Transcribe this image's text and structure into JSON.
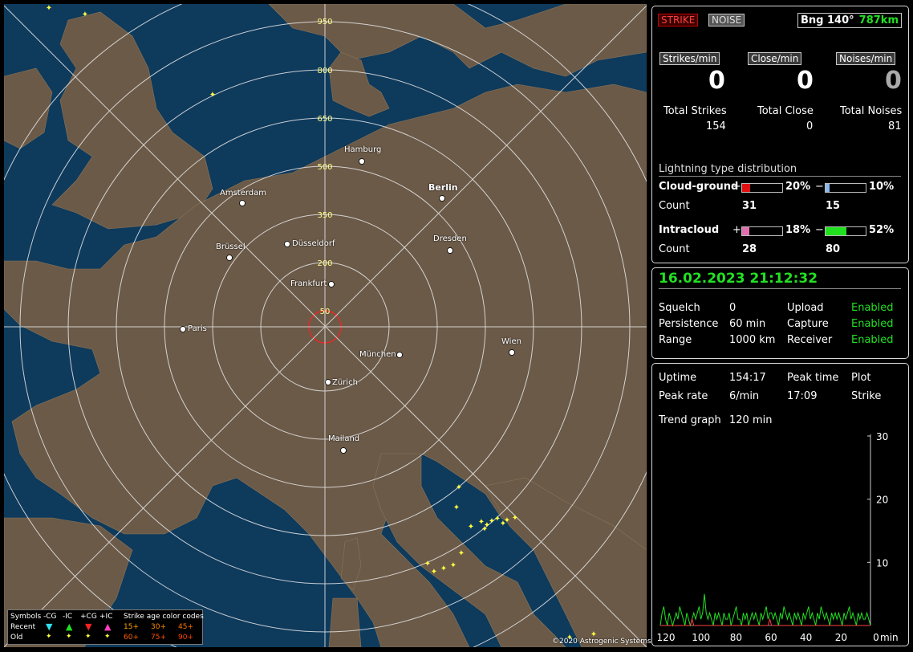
{
  "map": {
    "range_labels": [
      "950",
      "800",
      "650",
      "500",
      "350",
      "200",
      "50"
    ],
    "cities": [
      "Hamburg",
      "Berlin",
      "Amsterdam",
      "Düsseldorf",
      "Brüssel",
      "Dresden",
      "Frankfurt",
      "Paris",
      "Wien",
      "München",
      "Zürich",
      "Mailand"
    ],
    "copyright": "©2020 Astrogenic Systems",
    "legend": {
      "symbols_label": "Symbols",
      "types": [
        "-CG",
        "-IC",
        "+CG",
        "+IC"
      ],
      "recent_label": "Recent",
      "old_label": "Old",
      "age_title": "Strike age color codes",
      "age_recent": [
        "15+",
        "30+",
        "45+"
      ],
      "age_old": [
        "60+",
        "75+",
        "90+"
      ]
    },
    "colors": {
      "sea": "#0e3a5c",
      "land": "#6b5a48",
      "strike": "#ffff40"
    }
  },
  "top": {
    "strike_btn": "STRIKE",
    "noise_btn": "NOISE",
    "bearing_label": "Bng 140°",
    "bearing_distance": "787km",
    "rate_headers": [
      "Strikes/min",
      "Close/min",
      "Noises/min"
    ],
    "rates": [
      "0",
      "0",
      "0"
    ],
    "totals_labels": [
      "Total Strikes",
      "Total Close",
      "Total Noises"
    ],
    "totals": [
      "154",
      "0",
      "81"
    ],
    "dist_title": "Lightning type distribution",
    "cloud_ground_label": "Cloud-ground",
    "intracloud_label": "Intracloud",
    "count_label": "Count",
    "plus": "+",
    "minus": "−",
    "cg_pos_pct": "20%",
    "cg_neg_pct": "10%",
    "cg_pos_count": "31",
    "cg_neg_count": "15",
    "ic_pos_pct": "18%",
    "ic_neg_pct": "52%",
    "ic_pos_count": "28",
    "ic_neg_count": "80",
    "fractions": {
      "cg_pos": 0.2,
      "cg_neg": 0.1,
      "ic_pos": 0.18,
      "ic_neg": 0.52
    },
    "colors": {
      "cg_pos": "#e01010",
      "cg_neg": "#8ab8e8",
      "ic_pos": "#e070b0",
      "ic_neg": "#20e020"
    }
  },
  "status": {
    "datetime": "16.02.2023 21:12:32",
    "squelch_label": "Squelch",
    "squelch": "0",
    "persistence_label": "Persistence",
    "persistence": "60 min",
    "range_label": "Range",
    "range": "1000 km",
    "upload_label": "Upload",
    "upload": "Enabled",
    "capture_label": "Capture",
    "capture": "Enabled",
    "receiver_label": "Receiver",
    "receiver": "Enabled"
  },
  "stats": {
    "uptime_label": "Uptime",
    "uptime": "154:17",
    "peak_time_label": "Peak time",
    "peak_time": "17:09",
    "plot_label": "Plot",
    "plot": "Strike",
    "peak_rate_label": "Peak rate",
    "peak_rate": "6/min",
    "trend_label": "Trend graph",
    "trend": "120 min"
  },
  "chart_data": {
    "type": "line",
    "title": "",
    "xlabel": "min",
    "ylabel": "",
    "x_ticks": [
      "120",
      "100",
      "80",
      "60",
      "40",
      "20",
      "0"
    ],
    "y_ticks": [
      "10",
      "20",
      "30"
    ],
    "xlim": [
      120,
      0
    ],
    "ylim": [
      0,
      30
    ],
    "series": [
      {
        "color": "#20e020",
        "values": [
          0,
          2,
          3,
          1,
          0,
          2,
          1,
          0,
          1,
          2,
          1,
          3,
          2,
          1,
          0,
          2,
          1,
          0,
          1,
          2,
          1,
          2,
          3,
          1,
          2,
          5,
          2,
          1,
          2,
          1,
          0,
          2,
          1,
          2,
          1,
          0,
          2,
          1,
          1,
          2,
          0,
          1,
          2,
          3,
          1,
          1,
          0,
          2,
          1,
          2,
          0,
          1,
          2,
          1,
          2,
          1,
          0,
          2,
          1,
          2,
          3,
          1,
          2,
          2,
          1,
          2,
          1,
          0,
          2,
          1,
          3,
          2,
          1,
          2,
          1,
          0,
          2,
          1,
          2,
          1,
          0,
          2,
          1,
          2,
          3,
          1,
          2,
          1,
          0,
          2,
          1,
          3,
          2,
          1,
          2,
          1,
          0,
          2,
          1,
          2,
          1,
          2,
          1,
          0,
          2,
          1,
          2,
          3,
          1,
          2,
          1,
          0,
          2,
          1,
          2,
          1,
          1,
          2,
          1,
          0
        ]
      },
      {
        "color": "#ff4040",
        "values": [
          0,
          0,
          0,
          0,
          0,
          0,
          0,
          0,
          0,
          0,
          0,
          0,
          0,
          0,
          0,
          0,
          0,
          0,
          1,
          0,
          0,
          0,
          0,
          0,
          0,
          0,
          0,
          0,
          0,
          0,
          0,
          0,
          0,
          0,
          0,
          0,
          0,
          0,
          0,
          0,
          0,
          0,
          0,
          0,
          0,
          0,
          0,
          0,
          0,
          0,
          0,
          0,
          0,
          0,
          0,
          0,
          0,
          0,
          0,
          0,
          0,
          0,
          1,
          0,
          0,
          0,
          0,
          0,
          0,
          0,
          0,
          0,
          0,
          0,
          0,
          0,
          0,
          0,
          0,
          0,
          0,
          0,
          0,
          0,
          0,
          0,
          0,
          0,
          0,
          0,
          0,
          0,
          0,
          0,
          0,
          0,
          0,
          0,
          0,
          0,
          0,
          0,
          0,
          0,
          0,
          0,
          0,
          0,
          0,
          0,
          0,
          0,
          0,
          0,
          0,
          0,
          0,
          0,
          0,
          0
        ]
      }
    ]
  }
}
